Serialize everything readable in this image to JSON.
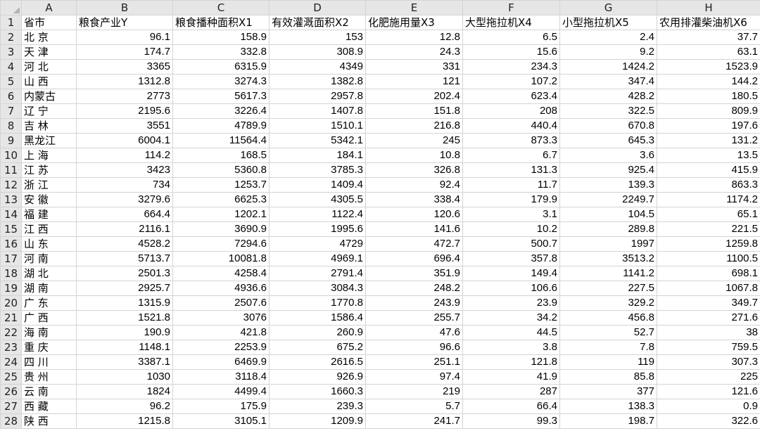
{
  "columns": [
    "A",
    "B",
    "C",
    "D",
    "E",
    "F",
    "G",
    "H"
  ],
  "header_row": [
    "省市",
    "粮食产业Y",
    "粮食播种面积X1",
    "有效灌溉面积X2",
    "化肥施用量X3",
    "大型拖拉机X4",
    "小型拖拉机X5",
    "农用排灌柴油机X6"
  ],
  "rows": [
    [
      "北 京",
      "96.1",
      "158.9",
      "153",
      "12.8",
      "6.5",
      "2.4",
      "37.7"
    ],
    [
      "天 津",
      "174.7",
      "332.8",
      "308.9",
      "24.3",
      "15.6",
      "9.2",
      "63.1"
    ],
    [
      "河 北",
      "3365",
      "6315.9",
      "4349",
      "331",
      "234.3",
      "1424.2",
      "1523.9"
    ],
    [
      "山 西",
      "1312.8",
      "3274.3",
      "1382.8",
      "121",
      "107.2",
      "347.4",
      "144.2"
    ],
    [
      "内蒙古",
      "2773",
      "5617.3",
      "2957.8",
      "202.4",
      "623.4",
      "428.2",
      "180.5"
    ],
    [
      "辽 宁",
      "2195.6",
      "3226.4",
      "1407.8",
      "151.8",
      "208",
      "322.5",
      "809.9"
    ],
    [
      "吉 林",
      "3551",
      "4789.9",
      "1510.1",
      "216.8",
      "440.4",
      "670.8",
      "197.6"
    ],
    [
      "黑龙江",
      "6004.1",
      "11564.4",
      "5342.1",
      "245",
      "873.3",
      "645.3",
      "131.2"
    ],
    [
      "上 海",
      "114.2",
      "168.5",
      "184.1",
      "10.8",
      "6.7",
      "3.6",
      "13.5"
    ],
    [
      "江 苏",
      "3423",
      "5360.8",
      "3785.3",
      "326.8",
      "131.3",
      "925.4",
      "415.9"
    ],
    [
      "浙 江",
      "734",
      "1253.7",
      "1409.4",
      "92.4",
      "11.7",
      "139.3",
      "863.3"
    ],
    [
      "安 徽",
      "3279.6",
      "6625.3",
      "4305.5",
      "338.4",
      "179.9",
      "2249.7",
      "1174.2"
    ],
    [
      "福 建",
      "664.4",
      "1202.1",
      "1122.4",
      "120.6",
      "3.1",
      "104.5",
      "65.1"
    ],
    [
      "江 西",
      "2116.1",
      "3690.9",
      "1995.6",
      "141.6",
      "10.2",
      "289.8",
      "221.5"
    ],
    [
      "山 东",
      "4528.2",
      "7294.6",
      "4729",
      "472.7",
      "500.7",
      "1997",
      "1259.8"
    ],
    [
      "河 南",
      "5713.7",
      "10081.8",
      "4969.1",
      "696.4",
      "357.8",
      "3513.2",
      "1100.5"
    ],
    [
      "湖 北",
      "2501.3",
      "4258.4",
      "2791.4",
      "351.9",
      "149.4",
      "1141.2",
      "698.1"
    ],
    [
      "湖 南",
      "2925.7",
      "4936.6",
      "3084.3",
      "248.2",
      "106.6",
      "227.5",
      "1067.8"
    ],
    [
      "广 东",
      "1315.9",
      "2507.6",
      "1770.8",
      "243.9",
      "23.9",
      "329.2",
      "349.7"
    ],
    [
      "广 西",
      "1521.8",
      "3076",
      "1586.4",
      "255.7",
      "34.2",
      "456.8",
      "271.6"
    ],
    [
      "海 南",
      "190.9",
      "421.8",
      "260.9",
      "47.6",
      "44.5",
      "52.7",
      "38"
    ],
    [
      "重 庆",
      "1148.1",
      "2253.9",
      "675.2",
      "96.6",
      "3.8",
      "7.8",
      "759.5"
    ],
    [
      "四 川",
      "3387.1",
      "6469.9",
      "2616.5",
      "251.1",
      "121.8",
      "119",
      "307.3"
    ],
    [
      "贵 州",
      "1030",
      "3118.4",
      "926.9",
      "97.4",
      "41.9",
      "85.8",
      "225"
    ],
    [
      "云 南",
      "1824",
      "4499.4",
      "1660.3",
      "219",
      "287",
      "377",
      "121.6"
    ],
    [
      "西 藏",
      "96.2",
      "175.9",
      "239.3",
      "5.7",
      "66.4",
      "138.3",
      "0.9"
    ],
    [
      "陕 西",
      "1215.8",
      "3105.1",
      "1209.9",
      "241.7",
      "99.3",
      "198.7",
      "322.6"
    ]
  ]
}
